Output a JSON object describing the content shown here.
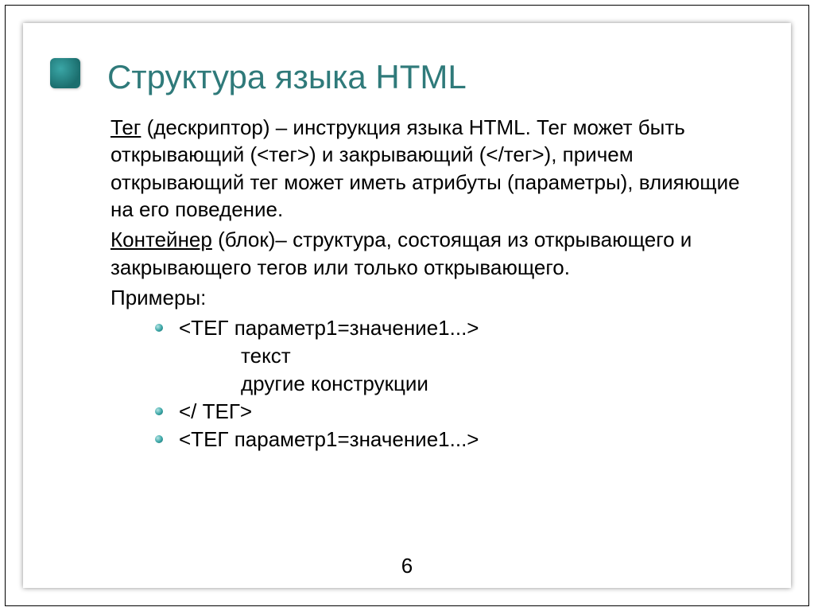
{
  "title": "Структура языка HTML",
  "para1_label": "Тег",
  "para1_rest": " (дескриптор) – инструкция языка HTML. Тег может быть открывающий (<тег>) и закрывающий (</тег>), причем открывающий тег может иметь атрибуты (параметры), влияющие на его поведение.",
  "para2_label": "Контейнер",
  "para2_rest": " (блок)– структура, состоящая из открывающего и закрывающего тегов или только открывающего.",
  "examples_label": "Примеры:",
  "ex1": "<ТЕГ параметр1=значение1...>",
  "ex1_sub1": "текст",
  "ex1_sub2": "другие конструкции",
  "ex2": "</ ТЕГ>",
  "ex3": "<ТЕГ параметр1=значение1...>",
  "page_number": "6"
}
